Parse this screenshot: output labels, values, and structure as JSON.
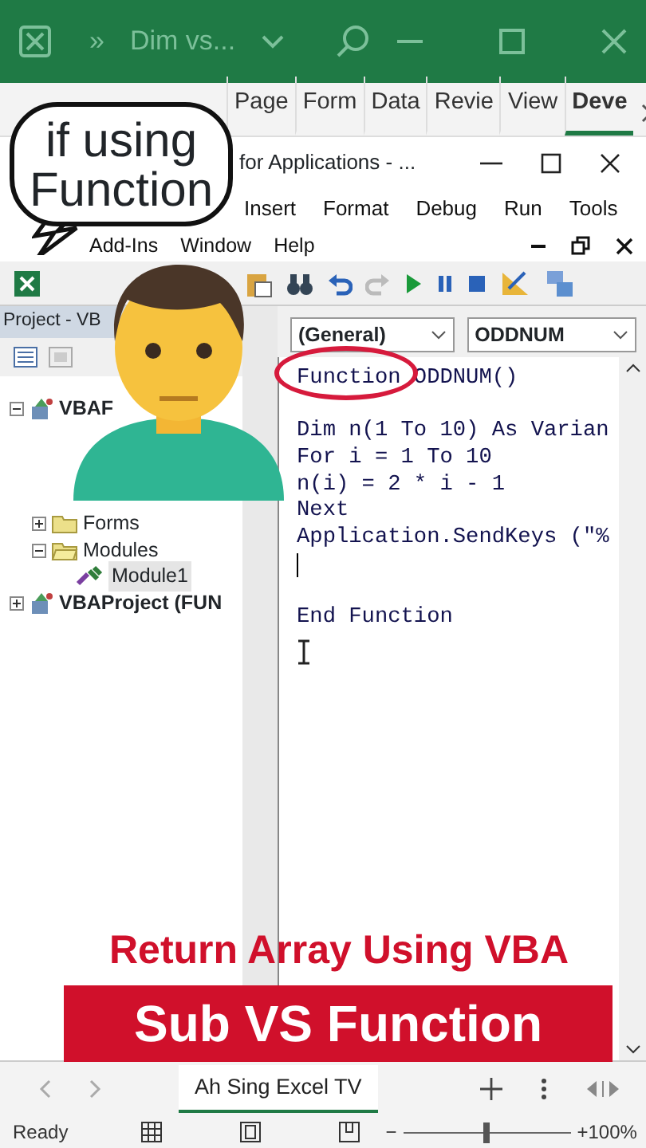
{
  "excel_title_bar": {
    "document_title": "Dim vs...",
    "more": "»"
  },
  "ribbon_tabs": [
    {
      "label": "Page",
      "selected": false
    },
    {
      "label": "Form",
      "selected": false
    },
    {
      "label": "Data",
      "selected": false
    },
    {
      "label": "Revie",
      "selected": false
    },
    {
      "label": "View",
      "selected": false
    },
    {
      "label": "Deve",
      "selected": true
    }
  ],
  "vbe_window": {
    "title": "for Applications - ...",
    "menu_row_1": [
      "Insert",
      "Format",
      "Debug",
      "Run",
      "Tools"
    ],
    "menu_row_2": [
      "Add-Ins",
      "Window",
      "Help"
    ]
  },
  "project_pane": {
    "title": "Project - VB",
    "tree": [
      {
        "label": "VBAF",
        "kind": "project",
        "expanded": true,
        "selected": false,
        "children": [
          {
            "label": "Forms",
            "kind": "folder",
            "expanded": false,
            "selected": false
          },
          {
            "label": "Modules",
            "kind": "folder",
            "expanded": true,
            "selected": false,
            "children": [
              {
                "label": "Module1",
                "kind": "module",
                "selected": true
              }
            ]
          }
        ]
      },
      {
        "label": "VBAProject (FUN",
        "kind": "project",
        "expanded": false,
        "selected": false
      }
    ]
  },
  "code_pane": {
    "object_combo": "(General)",
    "procedure_combo": "ODDNUM",
    "lines": [
      {
        "kind": "code",
        "text": "Function ODDNUM()"
      },
      {
        "kind": "blank"
      },
      {
        "kind": "code",
        "text": "Dim n(1 To 10) As Varian"
      },
      {
        "kind": "code",
        "text": "For i = 1 To 10"
      },
      {
        "kind": "code",
        "text": "n(i) = 2 * i - 1"
      },
      {
        "kind": "code",
        "text": "Next"
      },
      {
        "kind": "code",
        "text": "Application.SendKeys (\"%"
      },
      {
        "kind": "cursor"
      },
      {
        "kind": "blank"
      },
      {
        "kind": "code",
        "text": "End Function"
      }
    ]
  },
  "overlays": {
    "speech_bubble": "if using Function",
    "headline": "Return Array Using VBA",
    "banner": "Sub VS Function"
  },
  "sheet_tabs": [
    {
      "label": "Ah Sing Excel TV",
      "selected": true
    }
  ],
  "status_bar": {
    "mode": "Ready",
    "zoom_slider": {
      "level": 0.5
    },
    "zoom": "100%",
    "zoom_minus": "−",
    "zoom_plus": "+"
  }
}
